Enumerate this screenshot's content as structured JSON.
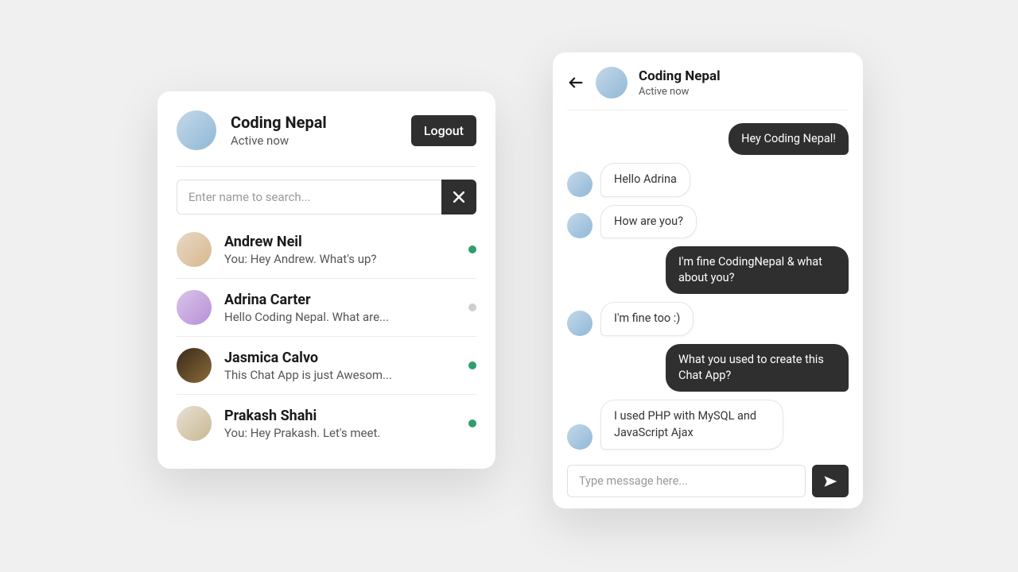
{
  "users_panel": {
    "profile": {
      "name": "Coding Nepal",
      "status": "Active now"
    },
    "logout_label": "Logout",
    "search": {
      "placeholder": "Enter name to search..."
    },
    "items": [
      {
        "name": "Andrew Neil",
        "msg": "You: Hey Andrew. What's up?",
        "online": true
      },
      {
        "name": "Adrina Carter",
        "msg": "Hello Coding Nepal. What are...",
        "online": false
      },
      {
        "name": "Jasmica Calvo",
        "msg": "This Chat App is just Awesom...",
        "online": true
      },
      {
        "name": "Prakash Shahi",
        "msg": "You: Hey Prakash. Let's meet.",
        "online": true
      }
    ]
  },
  "chat_panel": {
    "contact": {
      "name": "Coding Nepal",
      "status": "Active now"
    },
    "messages": [
      {
        "dir": "out",
        "text": "Hey Coding Nepal!"
      },
      {
        "dir": "in",
        "text": "Hello Adrina"
      },
      {
        "dir": "in",
        "text": "How are you?"
      },
      {
        "dir": "out",
        "text": "I'm fine CodingNepal & what about you?"
      },
      {
        "dir": "in",
        "text": "I'm fine too :)"
      },
      {
        "dir": "out",
        "text": "What you used to create this Chat App?"
      },
      {
        "dir": "in",
        "text": "I used PHP with MySQL and JavaScript Ajax"
      }
    ],
    "composer": {
      "placeholder": "Type message here..."
    }
  }
}
